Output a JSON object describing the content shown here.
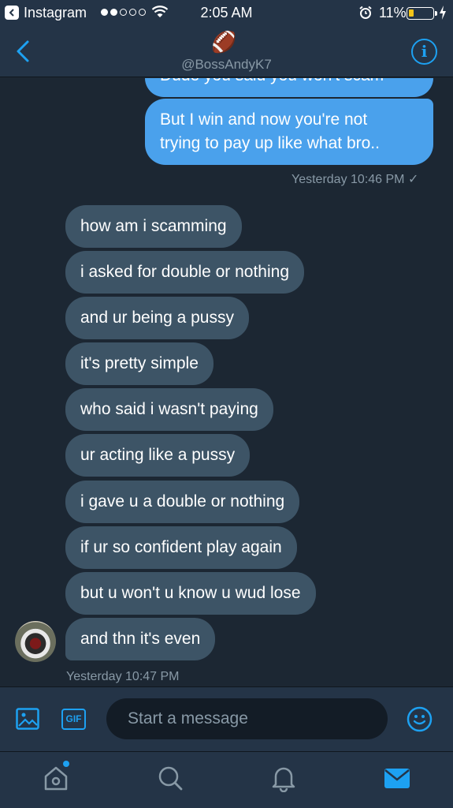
{
  "status_bar": {
    "app_name": "Instagram",
    "time": "2:05 AM",
    "battery_percent": "11%",
    "battery_level": 0.11,
    "signal_bars": 2
  },
  "header": {
    "emoji": "🏈",
    "handle": "@BossAndyK7",
    "info_label": "i"
  },
  "messages": {
    "sent": [
      {
        "text": "Dude you said you won't scam"
      },
      {
        "text": "But I win and now you're not"
      },
      {
        "text": "trying to pay up like what bro.."
      }
    ],
    "sent_meta": "Yesterday 10:46 PM ✓",
    "received": [
      "how am i scamming",
      "i asked for double or nothing",
      "and ur being a pussy",
      "it's pretty simple",
      "who said i wasn't paying",
      "ur acting like a pussy",
      "i gave u a double or nothing",
      "if ur so confident play again",
      "but u won't u know u wud lose",
      "and thn it's even"
    ],
    "received_meta": "Yesterday 10:47 PM"
  },
  "composer": {
    "gif_label": "GIF",
    "placeholder": "Start a message"
  },
  "tabs": [
    "home-icon",
    "search-icon",
    "notifications-icon",
    "messages-icon"
  ],
  "colors": {
    "background": "#1c2733",
    "bar": "#243447",
    "accent": "#1da1f2",
    "sent_bubble": "#4aa1ec",
    "received_bubble": "#3d5466",
    "muted_text": "#8899a6"
  }
}
